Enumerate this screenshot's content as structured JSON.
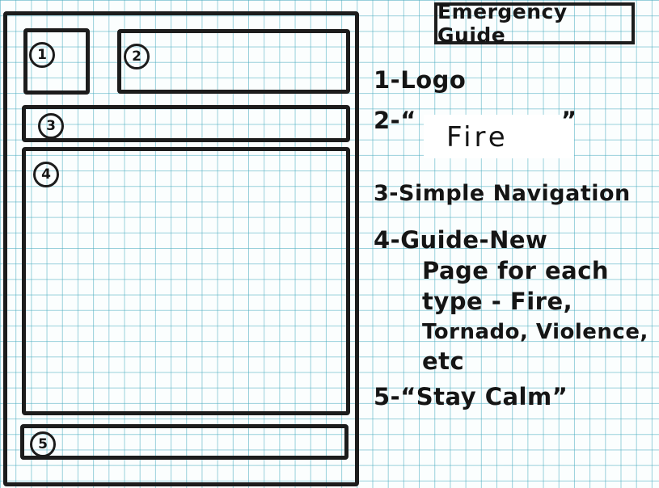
{
  "title": "Emergency Guide",
  "regions": [
    {
      "num": "1"
    },
    {
      "num": "2"
    },
    {
      "num": "3"
    },
    {
      "num": "4"
    },
    {
      "num": "5"
    }
  ],
  "notes": {
    "n1": "1-Logo",
    "n2_prefix": "2-“",
    "n2_word": "Fire",
    "n2_suffix": "”",
    "n3": "3-Simple Navigation",
    "n4_l1": "4-Guide-New",
    "n4_l2": "Page for each",
    "n4_l3": "type - Fire,",
    "n4_l4": "Tornado, Violence,",
    "n4_l5": "etc",
    "n5": "5-“Stay Calm”"
  }
}
